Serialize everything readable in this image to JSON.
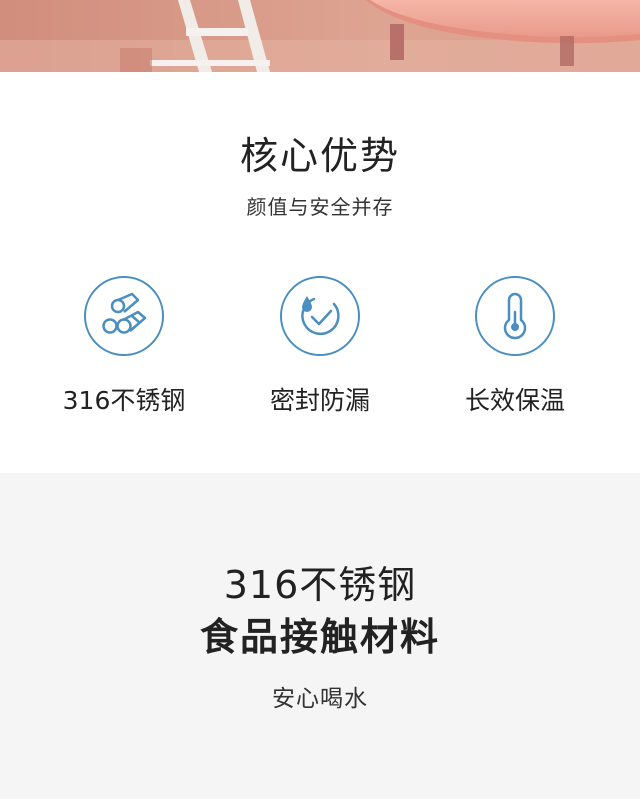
{
  "core": {
    "title": "核心优势",
    "subtitle": "颜值与安全并存",
    "features": [
      {
        "label": "316不锈钢",
        "icon": "pipes-icon"
      },
      {
        "label": "密封防漏",
        "icon": "water-drop-check-icon"
      },
      {
        "label": "长效保温",
        "icon": "thermometer-icon"
      }
    ]
  },
  "material": {
    "line1": "316不锈钢",
    "line2": "食品接触材料",
    "subtitle": "安心喝水"
  },
  "colors": {
    "icon_blue": "#4a8fc0",
    "section_gray": "#f5f5f5",
    "hero_pink": "#d89b89"
  }
}
